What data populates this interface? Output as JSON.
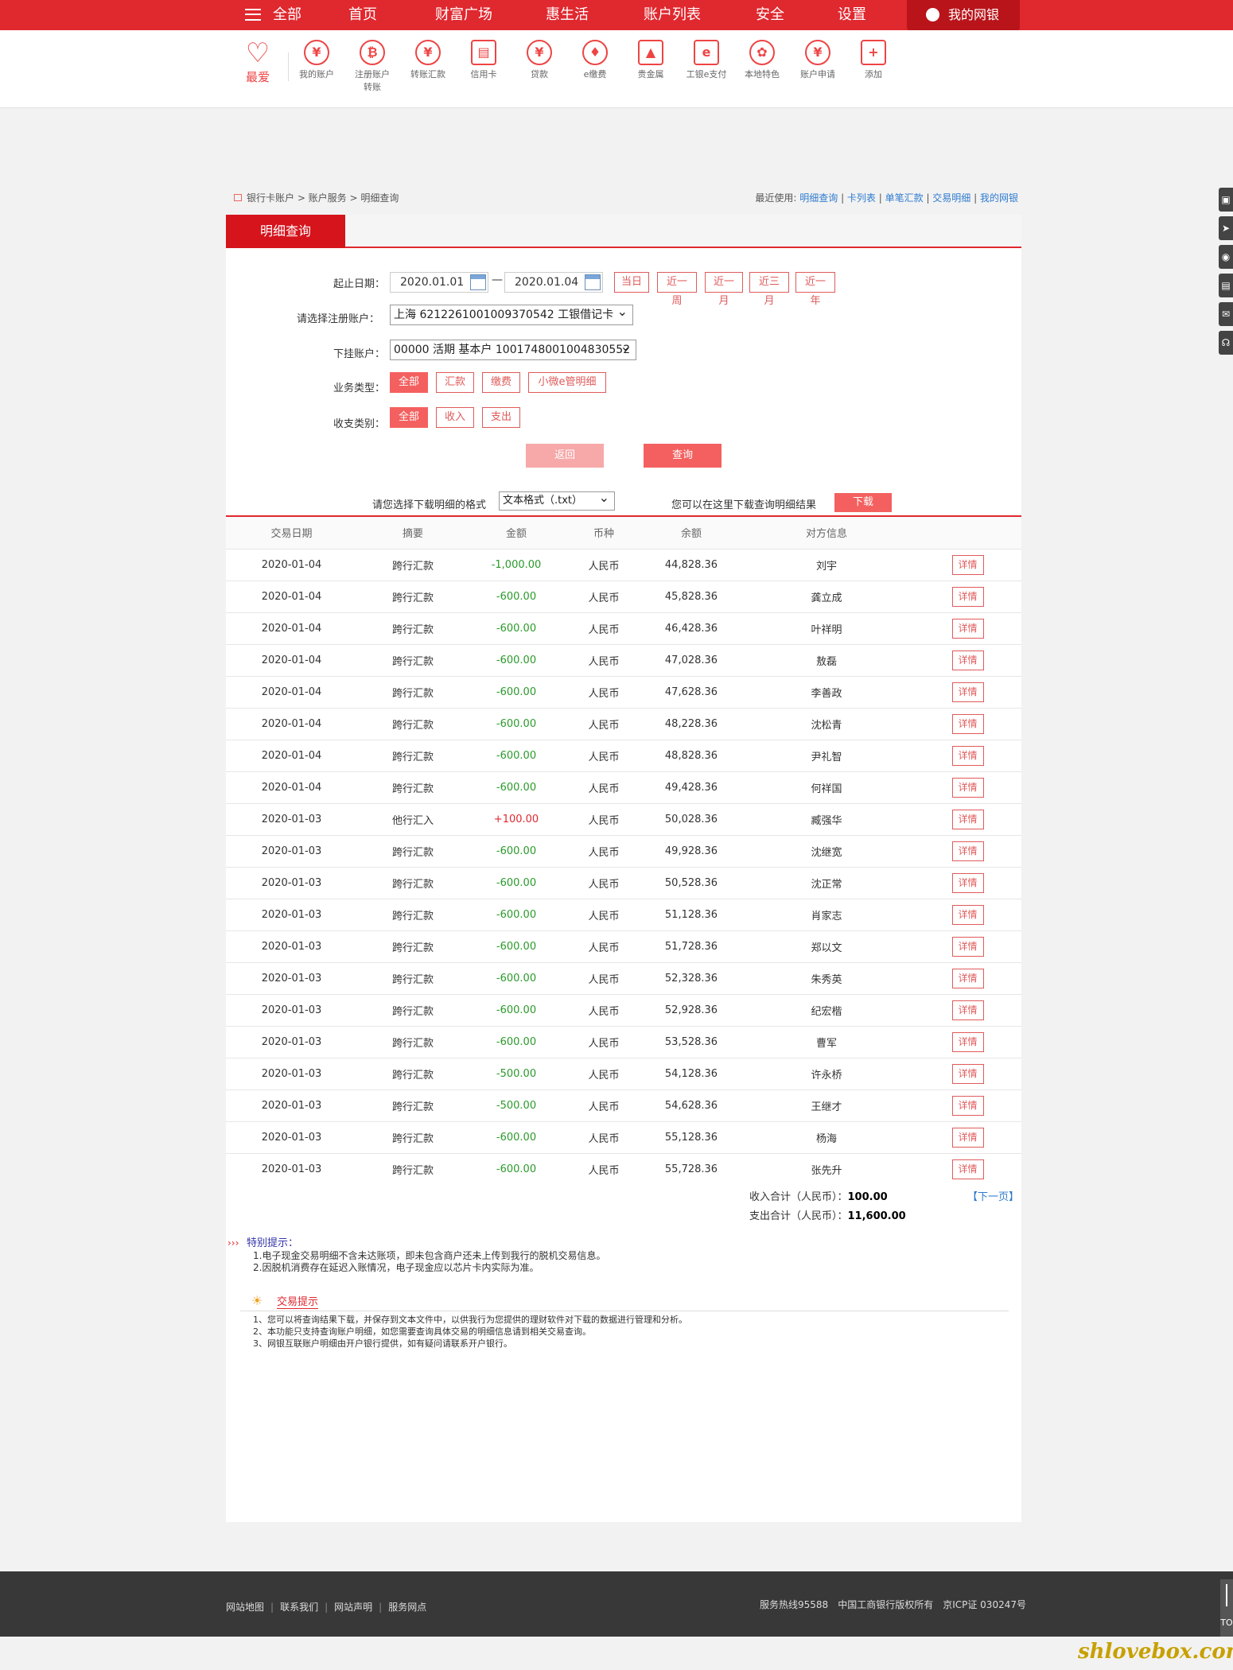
{
  "nav": {
    "all": "全部",
    "items": [
      "首页",
      "财富广场",
      "惠生活",
      "账户列表",
      "安全",
      "设置"
    ],
    "mybank": "我的网银"
  },
  "quick": {
    "favorite": "最爱",
    "items": [
      "我的账户",
      "注册账户转账",
      "转账汇款",
      "信用卡",
      "贷款",
      "e缴费",
      "贵金属",
      "工银e支付",
      "本地特色",
      "账户申请",
      "添加"
    ],
    "icons": [
      "yen-circle-icon",
      "transfer-icon",
      "yen-transfer-icon",
      "credit-card-icon",
      "loan-bag-icon",
      "drop-icon",
      "gold-bars-icon",
      "epay-icon",
      "local-icon",
      "yen-apply-icon",
      "plus-icon"
    ]
  },
  "breadcrumb": "银行卡账户 > 账户服务 > 明细查询",
  "recent": {
    "label": "最近使用:",
    "links": [
      "明细查询",
      "卡列表",
      "单笔汇款",
      "交易明细",
      "我的网银"
    ]
  },
  "tab": "明细查询",
  "form": {
    "date_label": "起止日期：",
    "start_date": "2020.01.01",
    "dash": "—",
    "end_date": "2020.01.04",
    "quick_ranges": [
      "当日",
      "近一周",
      "近一月",
      "近三月",
      "近一年"
    ],
    "account_label": "请选择注册账户：",
    "account_value": "上海 6212261001009370542 工银借记卡",
    "sub_label": "下挂账户：",
    "sub_value": "00000 活期 基本户 1001748001004830552",
    "biz_label": "业务类型：",
    "biz_types": [
      "全部",
      "汇款",
      "缴费",
      "小微e管明细"
    ],
    "io_label": "收支类别：",
    "io_types": [
      "全部",
      "收入",
      "支出"
    ],
    "back": "返回",
    "query": "查询"
  },
  "download": {
    "format_label": "请您选择下载明细的格式",
    "format_value": "文本格式（.txt）",
    "hint": "您可以在这里下载查询明细结果",
    "button": "下载"
  },
  "table": {
    "headers": [
      "交易日期",
      "摘要",
      "金额",
      "币种",
      "余额",
      "对方信息",
      ""
    ],
    "detail_label": "详情",
    "rows": [
      [
        "2020-01-04",
        "跨行汇款",
        "-1,000.00",
        "人民币",
        "44,828.36",
        "刘宇"
      ],
      [
        "2020-01-04",
        "跨行汇款",
        "-600.00",
        "人民币",
        "45,828.36",
        "龚立成"
      ],
      [
        "2020-01-04",
        "跨行汇款",
        "-600.00",
        "人民币",
        "46,428.36",
        "叶祥明"
      ],
      [
        "2020-01-04",
        "跨行汇款",
        "-600.00",
        "人民币",
        "47,028.36",
        "敖磊"
      ],
      [
        "2020-01-04",
        "跨行汇款",
        "-600.00",
        "人民币",
        "47,628.36",
        "李善政"
      ],
      [
        "2020-01-04",
        "跨行汇款",
        "-600.00",
        "人民币",
        "48,228.36",
        "沈松青"
      ],
      [
        "2020-01-04",
        "跨行汇款",
        "-600.00",
        "人民币",
        "48,828.36",
        "尹礼智"
      ],
      [
        "2020-01-04",
        "跨行汇款",
        "-600.00",
        "人民币",
        "49,428.36",
        "何祥国"
      ],
      [
        "2020-01-03",
        "他行汇入",
        "+100.00",
        "人民币",
        "50,028.36",
        "臧强华"
      ],
      [
        "2020-01-03",
        "跨行汇款",
        "-600.00",
        "人民币",
        "49,928.36",
        "沈继宽"
      ],
      [
        "2020-01-03",
        "跨行汇款",
        "-600.00",
        "人民币",
        "50,528.36",
        "沈正常"
      ],
      [
        "2020-01-03",
        "跨行汇款",
        "-600.00",
        "人民币",
        "51,128.36",
        "肖家志"
      ],
      [
        "2020-01-03",
        "跨行汇款",
        "-600.00",
        "人民币",
        "51,728.36",
        "郑以文"
      ],
      [
        "2020-01-03",
        "跨行汇款",
        "-600.00",
        "人民币",
        "52,328.36",
        "朱秀英"
      ],
      [
        "2020-01-03",
        "跨行汇款",
        "-600.00",
        "人民币",
        "52,928.36",
        "纪宏楷"
      ],
      [
        "2020-01-03",
        "跨行汇款",
        "-600.00",
        "人民币",
        "53,528.36",
        "曹军"
      ],
      [
        "2020-01-03",
        "跨行汇款",
        "-500.00",
        "人民币",
        "54,128.36",
        "许永桥"
      ],
      [
        "2020-01-03",
        "跨行汇款",
        "-500.00",
        "人民币",
        "54,628.36",
        "王继才"
      ],
      [
        "2020-01-03",
        "跨行汇款",
        "-600.00",
        "人民币",
        "55,128.36",
        "杨海"
      ],
      [
        "2020-01-03",
        "跨行汇款",
        "-600.00",
        "人民币",
        "55,728.36",
        "张先升"
      ]
    ]
  },
  "totals": {
    "income_label": "收入合计（人民币）：",
    "income": "100.00",
    "expense_label": "支出合计（人民币）：",
    "expense": "11,600.00",
    "next_page": "【下一页】"
  },
  "notice": {
    "title": "特别提示：",
    "lines": [
      "1.电子现金交易明细不含未达账项，即未包含商户还未上传到我行的脱机交易信息。",
      "2.因脱机消费存在延迟入账情况，电子现金应以芯片卡内实际为准。"
    ]
  },
  "tips": {
    "title": "交易提示",
    "lines": [
      "1、您可以将查询结果下载，并保存到文本文件中，以供我行为您提供的理财软件对下载的数据进行管理和分析。",
      "2、本功能只支持查询账户明细，如您需要查询具体交易的明细信息请到相关交易查询。",
      "3、网银互联账户明细由开户银行提供，如有疑问请联系开户银行。"
    ]
  },
  "footer": {
    "links": [
      "网站地图",
      "联系我们",
      "网站声明",
      "服务网点"
    ],
    "hotline": "服务热线95588",
    "copyright": "中国工商银行版权所有",
    "icp": "京ICP证 030247号"
  },
  "side": {
    "top_label": "TO"
  },
  "watermark": "shlovebox.com",
  "colors": {
    "brand_red": "#e0282f",
    "dark_red": "#d5141c",
    "button_red": "#f3605f",
    "negative": "#2a9a2a",
    "positive": "#e0282f",
    "link_blue": "#2e7bcf"
  }
}
